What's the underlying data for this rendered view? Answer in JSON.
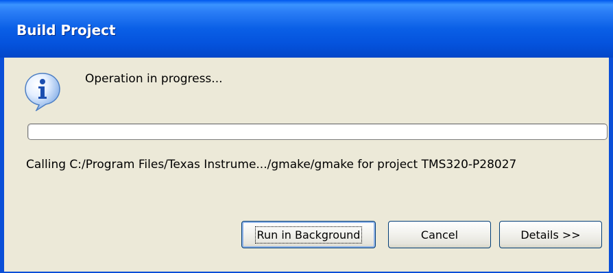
{
  "window": {
    "title": "Build Project"
  },
  "dialog": {
    "icon": "info-icon",
    "message": "Operation in progress...",
    "progress_fraction": 0.0,
    "status": "Calling C:/Program Files/Texas Instrume.../gmake/gmake for project TMS320-P28027"
  },
  "buttons": {
    "run_in_background": "Run in Background",
    "cancel": "Cancel",
    "details": "Details >>"
  },
  "colors": {
    "titlebar": "#0a5fe6",
    "dialog_background": "#ece9d8",
    "button_border": "#003c74"
  }
}
